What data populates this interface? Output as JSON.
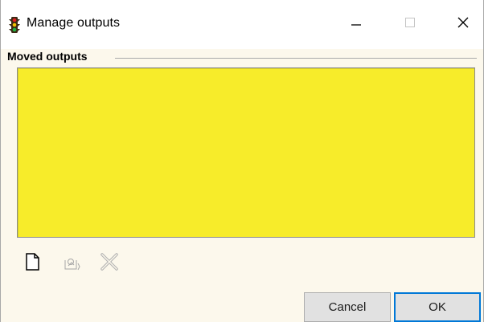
{
  "window": {
    "title": "Manage outputs",
    "icon": "traffic-light-icon"
  },
  "titlebar_buttons": {
    "minimize": "minimize-icon",
    "maximize": "maximize-icon",
    "close": "close-icon"
  },
  "group": {
    "label": "Moved outputs"
  },
  "list": {
    "background_color": "#f7ec2a",
    "items": []
  },
  "toolbar": {
    "items": [
      {
        "name": "new-icon",
        "enabled": true
      },
      {
        "name": "edit-icon",
        "enabled": false
      },
      {
        "name": "delete-icon",
        "enabled": false
      }
    ]
  },
  "buttons": {
    "cancel_label": "Cancel",
    "ok_label": "OK"
  },
  "colors": {
    "window_background": "#fcf8ec",
    "default_button_border": "#0078d7"
  }
}
